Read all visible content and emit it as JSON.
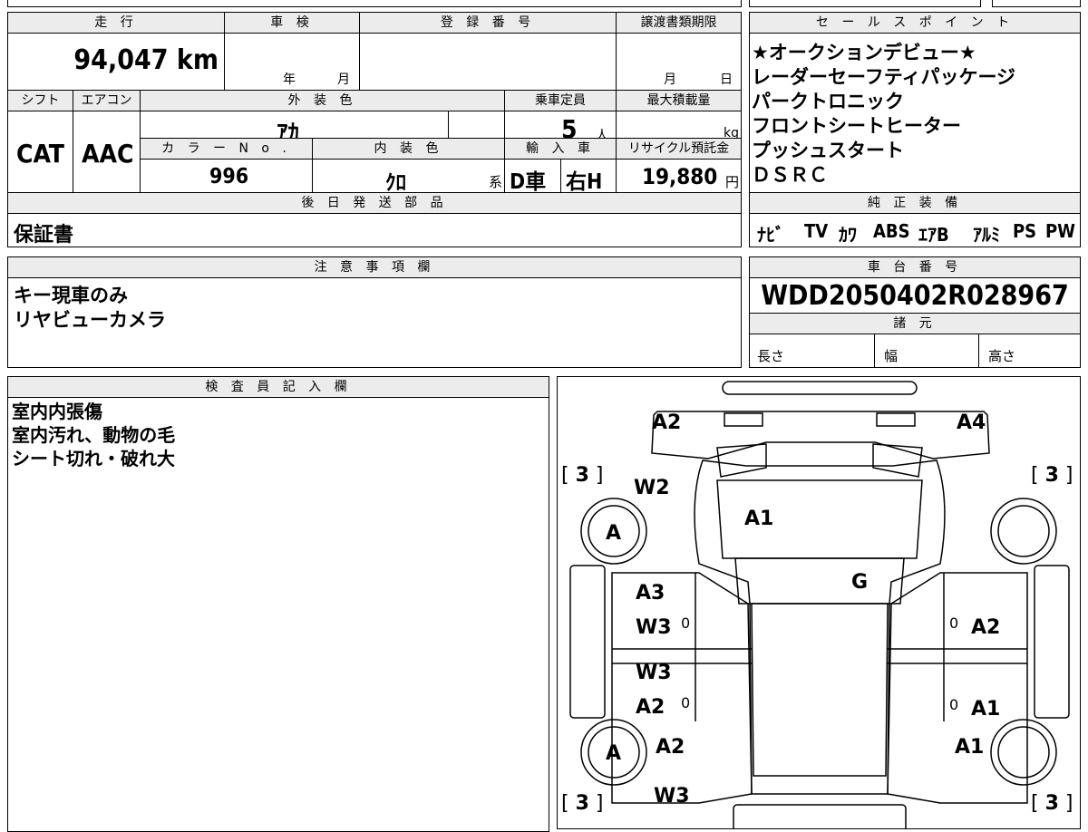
{
  "spec": {
    "mileage": {
      "label": "走 行",
      "value": "94,047 km"
    },
    "inspection": {
      "label": "車 検",
      "year_unit": "年",
      "month_unit": "月"
    },
    "registration": {
      "label": "登 録 番 号",
      "value": ""
    },
    "transfer_deadline": {
      "label": "譲渡書類期限",
      "month_unit": "月",
      "day_unit": "日"
    },
    "shift": {
      "label": "シフト",
      "value": "CAT"
    },
    "aircon": {
      "label": "エアコン",
      "value": "AAC"
    },
    "exterior_color": {
      "label": "外 装 色",
      "value": "ｱｶ"
    },
    "capacity": {
      "label": "乗車定員",
      "value": "5",
      "unit": "人"
    },
    "max_load": {
      "label": "最大積載量",
      "unit": "kg"
    },
    "color_no": {
      "label": "カ ラ ー N o .",
      "value": "996"
    },
    "interior_color": {
      "label": "内 装 色",
      "value": "ｸﾛ",
      "unit": "系"
    },
    "import": {
      "label": "輸 入 車",
      "drive": "D車",
      "handle": "右H"
    },
    "recycle": {
      "label": "リサイクル預託金",
      "value": "19,880",
      "unit": "円"
    }
  },
  "later_shipment": {
    "label": "後 日 発 送 部 品",
    "value": "保証書"
  },
  "sales_points": {
    "label": "セ ー ル ス ポ イ ン ト",
    "items": [
      "★オークションデビュー★",
      "レーダーセーフティパッケージ",
      "パークトロニック",
      "フロントシートヒーター",
      "プッシュスタート",
      "ＤＳＲＣ"
    ]
  },
  "equipment": {
    "label": "純 正 装 備",
    "items": [
      "ﾅﾋﾞ",
      "TV",
      "ｶﾜ",
      "ABS",
      "ｴｱB",
      "ｱﾙﾐ",
      "PS",
      "PW"
    ]
  },
  "notes": {
    "label": "注 意 事 項 欄",
    "items": [
      "キー現車のみ",
      "リヤビューカメラ"
    ]
  },
  "chassis": {
    "label": "車 台 番 号",
    "value": "WDD2050402R028967"
  },
  "dimensions": {
    "label": "諸 元",
    "length": "長さ",
    "width": "幅",
    "height": "高さ"
  },
  "inspector": {
    "label": "検 査 員 記 入 欄",
    "items": [
      "室内内張傷",
      "室内汚れ、動物の毛",
      "シート切れ・破れ大"
    ]
  },
  "diagram": {
    "labels": {
      "rear_left": "A2",
      "rear_right": "A4",
      "left_top_w": "W2",
      "roof": "A1",
      "glass": "G",
      "tire_top": "A",
      "tire_bottom": "A",
      "l_door1a": "A3",
      "l_door1b": "W3",
      "l_door2a": "W3",
      "l_door2b": "A2",
      "r_door1": "A2",
      "r_door2": "A1",
      "l_fender": "A2",
      "l_bottom_w": "W3",
      "r_fender": "A1",
      "zero": "0",
      "tread": "3"
    }
  }
}
